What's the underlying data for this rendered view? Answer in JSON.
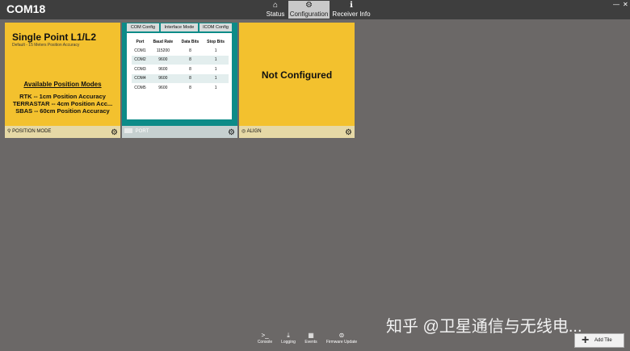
{
  "app": {
    "title": "COM18"
  },
  "nav": [
    {
      "label": "Status",
      "icon": "home-icon"
    },
    {
      "label": "Configuration",
      "icon": "gear-icon"
    },
    {
      "label": "Receiver Info",
      "icon": "info-icon"
    }
  ],
  "window_controls": {
    "minimize": "—",
    "close": "✕"
  },
  "tiles": {
    "position_mode": {
      "title": "Single Point L1/L2",
      "subtitle": "Default - 15 Meters Position Accuracy",
      "available_heading": "Available Position Modes",
      "modes": [
        "RTK -- 1cm Position Accuracy",
        "TERRASTAR -- 4cm Position Acc...",
        "SBAS -- 60cm Position Accuracy"
      ],
      "footer": "POSITION MODE"
    },
    "port": {
      "tabs": [
        "COM Config",
        "Interface Mode",
        "ICOM Config"
      ],
      "columns": [
        "Port",
        "Baud Rate",
        "Data Bits",
        "Stop Bits"
      ],
      "rows": [
        [
          "COM1",
          "115200",
          "8",
          "1"
        ],
        [
          "COM2",
          "9600",
          "8",
          "1"
        ],
        [
          "COM3",
          "9600",
          "8",
          "1"
        ],
        [
          "COM4",
          "9600",
          "8",
          "1"
        ],
        [
          "COM5",
          "9600",
          "8",
          "1"
        ]
      ],
      "footer": "PORT"
    },
    "align": {
      "status": "Not Configured",
      "footer": "ALIGN"
    }
  },
  "bottom_bar": [
    {
      "label": "Console",
      "icon": "console-icon"
    },
    {
      "label": "Logging",
      "icon": "download-icon"
    },
    {
      "label": "Events",
      "icon": "calendar-icon"
    },
    {
      "label": "Firmware Update",
      "icon": "firmware-icon"
    }
  ],
  "add_tile": {
    "label": "Add Tile"
  },
  "watermark": "知乎 @卫星通信与无线电..."
}
